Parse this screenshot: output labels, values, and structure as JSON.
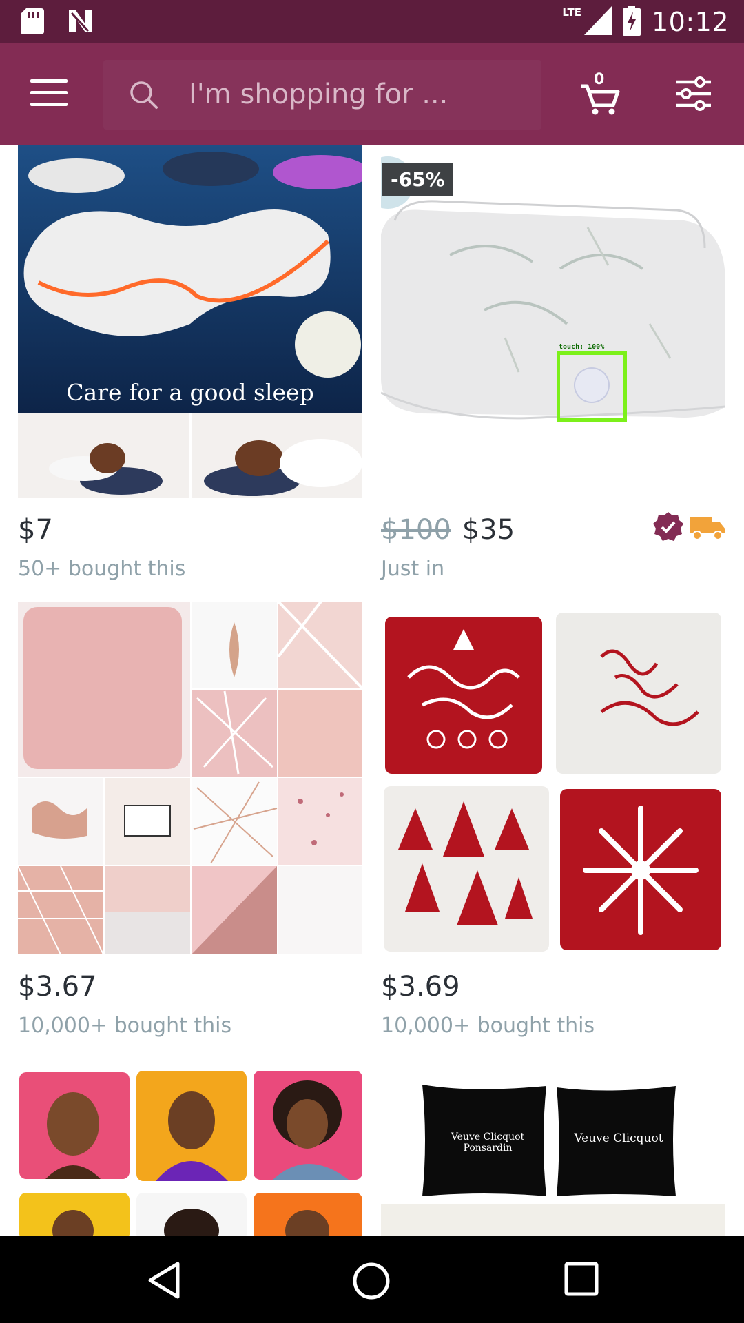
{
  "status_bar": {
    "time": "10:12",
    "network": "LTE",
    "left_icons": [
      "sd-card-icon",
      "n-logo-icon"
    ],
    "right_icons": [
      "signal-icon",
      "battery-charging-icon"
    ]
  },
  "app_bar": {
    "search_placeholder": "I'm shopping for ...",
    "cart_count": "0",
    "icons": [
      "menu-icon",
      "search-icon",
      "cart-icon",
      "filter-icon"
    ],
    "background_color": "#832c54",
    "status_color": "#5d1d3d"
  },
  "products": [
    {
      "image_caption": "Care for a good sleep",
      "price": "$7",
      "subtitle": "50+ bought this"
    },
    {
      "discount": "-65%",
      "old_price": "$100",
      "price": "$35",
      "subtitle": "Just in",
      "badges": [
        "verified-badge-icon",
        "shipping-truck-icon"
      ]
    },
    {
      "price": "$3.67",
      "subtitle": "10,000+ bought this"
    },
    {
      "price": "$3.69",
      "subtitle": "10,000+ bought this"
    },
    {
      "price": "",
      "subtitle": ""
    },
    {
      "pillow_texts": [
        "Veuve Clicquot Ponsardin",
        "Veuve Clicquot"
      ]
    }
  ],
  "touch_overlay": {
    "label": "touch: 100%"
  },
  "nav_bar": {
    "icons": [
      "back-icon",
      "home-icon",
      "recents-icon"
    ]
  }
}
